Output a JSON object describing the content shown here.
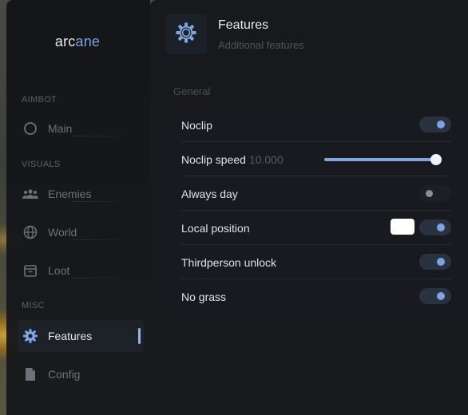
{
  "app": {
    "logo_prefix": "arc",
    "logo_suffix": "ane",
    "accent_color": "#7aa3e0"
  },
  "sidebar": {
    "sections": [
      {
        "label": "AIMBOT",
        "items": [
          {
            "label": "Main",
            "icon": "target-icon"
          }
        ]
      },
      {
        "label": "VISUALS",
        "items": [
          {
            "label": "Enemies",
            "icon": "users-icon"
          },
          {
            "label": "World",
            "icon": "globe-icon"
          },
          {
            "label": "Loot",
            "icon": "box-icon"
          }
        ]
      },
      {
        "label": "MISC",
        "items": [
          {
            "label": "Features",
            "icon": "gear-icon",
            "active": true
          },
          {
            "label": "Config",
            "icon": "file-icon"
          }
        ]
      }
    ]
  },
  "header": {
    "icon": "gear-icon",
    "title": "Features",
    "subtitle": "Additional features"
  },
  "group": {
    "label": "General",
    "rows": [
      {
        "label": "Noclip",
        "type": "toggle",
        "on": true
      },
      {
        "label": "Noclip speed",
        "type": "slider",
        "value": "10.000",
        "fraction": 1.0
      },
      {
        "label": "Always day",
        "type": "toggle",
        "on": false
      },
      {
        "label": "Local position",
        "type": "toggle+color",
        "on": true,
        "color": "#ffffff"
      },
      {
        "label": "Thirdperson unlock",
        "type": "toggle",
        "on": true
      },
      {
        "label": "No grass",
        "type": "toggle",
        "on": true
      }
    ]
  }
}
